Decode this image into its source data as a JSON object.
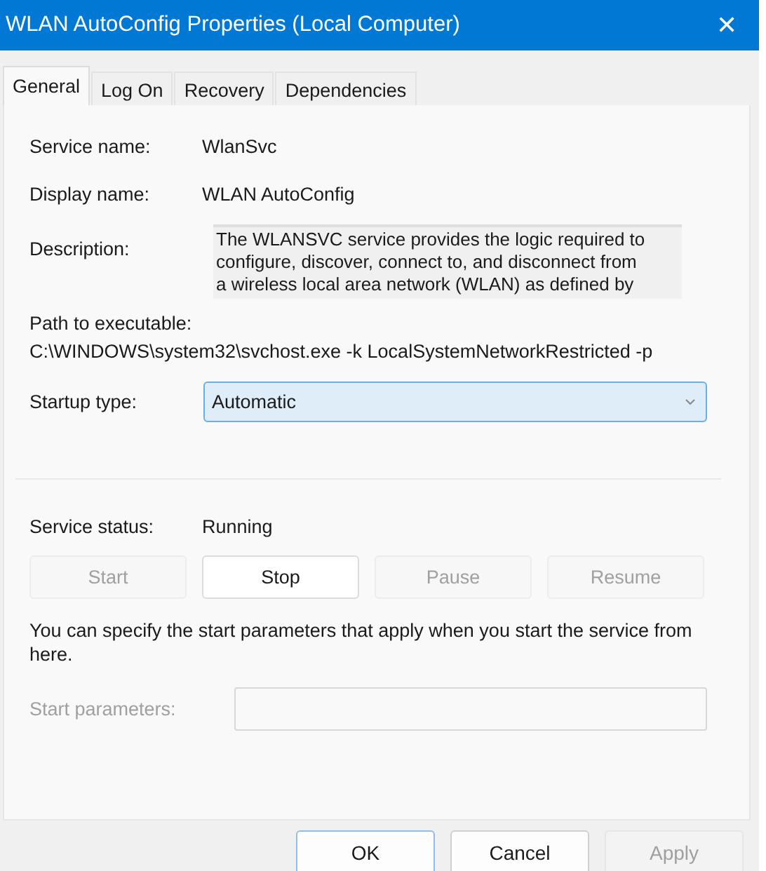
{
  "window": {
    "title": "WLAN AutoConfig Properties (Local Computer)",
    "close": "✕"
  },
  "tabs": [
    {
      "label": "General",
      "selected": true
    },
    {
      "label": "Log On",
      "selected": false
    },
    {
      "label": "Recovery",
      "selected": false
    },
    {
      "label": "Dependencies",
      "selected": false
    }
  ],
  "service_name": {
    "label": "Service name:",
    "value": "WlanSvc"
  },
  "display_name": {
    "label": "Display name:",
    "value": "WLAN AutoConfig"
  },
  "description": {
    "label": "Description:",
    "lines": [
      "The WLANSVC service provides the logic required to",
      "configure, discover, connect to, and disconnect from",
      "a wireless local area network (WLAN) as defined by"
    ]
  },
  "path": {
    "label": "Path to executable:",
    "value": "C:\\WINDOWS\\system32\\svchost.exe -k LocalSystemNetworkRestricted -p"
  },
  "startup_type": {
    "label": "Startup type:",
    "value": "Automatic",
    "focused": true
  },
  "service_status": {
    "label": "Service status:",
    "value": "Running"
  },
  "service_buttons": [
    {
      "label": "Start",
      "disabled": true
    },
    {
      "label": "Stop",
      "disabled": false
    },
    {
      "label": "Pause",
      "disabled": true
    },
    {
      "label": "Resume",
      "disabled": true
    }
  ],
  "hint": "You can specify the start parameters that apply when you start the service from here.",
  "start_parameters": {
    "label": "Start parameters:",
    "disabled": true
  },
  "dialog_buttons": [
    {
      "label": "OK",
      "default": true,
      "disabled": false
    },
    {
      "label": "Cancel",
      "default": false,
      "disabled": false
    },
    {
      "label": "Apply",
      "default": false,
      "disabled": true
    }
  ]
}
